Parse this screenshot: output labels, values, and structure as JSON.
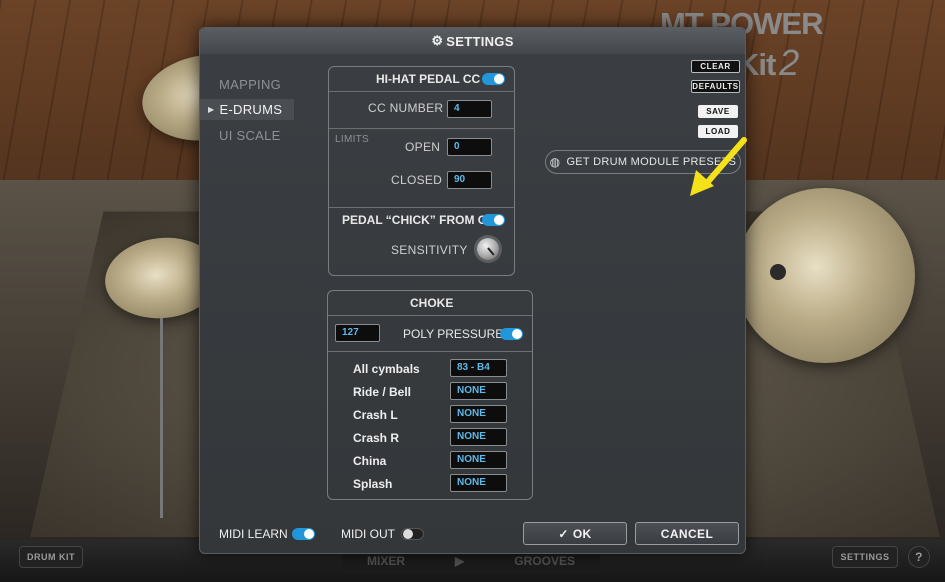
{
  "watermark": {
    "brand": "MT POWER DrumKit",
    "version": "2"
  },
  "bottom_bar": {
    "drum_kit": "DRUM KIT",
    "mixer": "MIXER",
    "grooves": "GROOVES",
    "settings": "SETTINGS",
    "help": "?"
  },
  "dialog": {
    "title": "SETTINGS",
    "nav": [
      {
        "label": "MAPPING",
        "active": false
      },
      {
        "label": "E-DRUMS",
        "active": true
      },
      {
        "label": "UI SCALE",
        "active": false
      }
    ],
    "hihat": {
      "header": "HI-HAT PEDAL CC",
      "enabled": true,
      "cc_number_label": "CC NUMBER",
      "cc_number": "4",
      "limits_label": "LIMITS",
      "open_label": "OPEN",
      "open_value": "0",
      "closed_label": "CLOSED",
      "closed_value": "90",
      "pedal_chick_label": "PEDAL “CHICK” FROM CC",
      "pedal_chick_enabled": true,
      "sensitivity_label": "SENSITIVITY"
    },
    "choke": {
      "header": "CHOKE",
      "value": "127",
      "poly_pressure_label": "POLY PRESSURE",
      "poly_pressure_enabled": true,
      "rows": [
        {
          "label": "All  cymbals",
          "value": "83 - B4"
        },
        {
          "label": "Ride / Bell",
          "value": "NONE"
        },
        {
          "label": "Crash L",
          "value": "NONE"
        },
        {
          "label": "Crash R",
          "value": "NONE"
        },
        {
          "label": "China",
          "value": "NONE"
        },
        {
          "label": "Splash",
          "value": "NONE"
        }
      ]
    },
    "side_buttons": {
      "clear": "CLEAR",
      "defaults": "DEFAULTS",
      "save": "SAVE",
      "load": "LOAD"
    },
    "presets_button": "GET DRUM MODULE PRESETS",
    "footer": {
      "midi_learn_label": "MIDI LEARN",
      "midi_learn_enabled": true,
      "midi_out_label": "MIDI OUT",
      "midi_out_enabled": false,
      "ok_label": "OK",
      "cancel_label": "CANCEL"
    }
  },
  "colors": {
    "accent": "#2196d9",
    "field_text": "#5fb8e8",
    "arrow": "#f5e11a"
  },
  "icons": {
    "title": "gear-icon",
    "presets": "globe-icon",
    "ok": "checkmark-icon"
  }
}
